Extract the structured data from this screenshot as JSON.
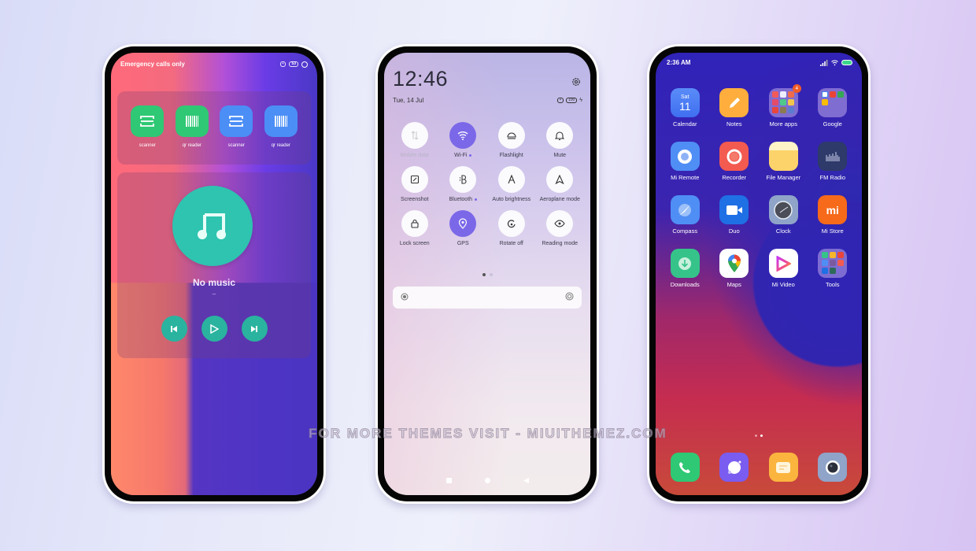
{
  "phone1": {
    "status_text": "Emergency calls only",
    "status_icons": [
      "screen-record-icon",
      "battery-53-icon",
      "settings-circle-icon"
    ],
    "battery_level": "53",
    "widgets": [
      {
        "label": "scanner",
        "icon": "scanner-icon",
        "color": "#2fc874"
      },
      {
        "label": "qr reader",
        "icon": "barcode-icon",
        "color": "#2fc874"
      },
      {
        "label": "scanner",
        "icon": "scanner-icon",
        "color": "#4b8ef6"
      },
      {
        "label": "qr reader",
        "icon": "barcode-icon",
        "color": "#4b8ef6"
      }
    ],
    "music": {
      "title": "No music",
      "subtitle": "–",
      "controls": [
        "previous",
        "play",
        "next"
      ],
      "accent": "#2ec4b0"
    }
  },
  "phone2": {
    "time": "12:46",
    "date": "Tue, 14 Jul",
    "battery_level": "100",
    "tiles": [
      {
        "label": "Mobile data",
        "icon": "mobile-data-icon",
        "active": false,
        "disabled": true,
        "dot": false
      },
      {
        "label": "Wi-Fi",
        "icon": "wifi-icon",
        "active": true,
        "disabled": false,
        "dot": true
      },
      {
        "label": "Flashlight",
        "icon": "flashlight-icon",
        "active": false,
        "disabled": false,
        "dot": false
      },
      {
        "label": "Mute",
        "icon": "bell-icon",
        "active": false,
        "disabled": false,
        "dot": false
      },
      {
        "label": "Screenshot",
        "icon": "screenshot-icon",
        "active": false,
        "disabled": false,
        "dot": false
      },
      {
        "label": "Bluetooth",
        "icon": "bluetooth-icon",
        "active": false,
        "disabled": false,
        "dot": true
      },
      {
        "label": "Auto brightness",
        "icon": "auto-brightness-icon",
        "active": false,
        "disabled": false,
        "dot": false
      },
      {
        "label": "Aeroplane mode",
        "icon": "aeroplane-icon",
        "active": false,
        "disabled": false,
        "dot": false
      },
      {
        "label": "Lock screen",
        "icon": "lock-icon",
        "active": false,
        "disabled": false,
        "dot": false
      },
      {
        "label": "GPS",
        "icon": "location-icon",
        "active": true,
        "disabled": false,
        "dot": false
      },
      {
        "label": "Rotate off",
        "icon": "rotate-icon",
        "active": false,
        "disabled": false,
        "dot": false
      },
      {
        "label": "Reading mode",
        "icon": "eye-icon",
        "active": false,
        "disabled": false,
        "dot": false
      }
    ],
    "page_indicator": {
      "current": 1,
      "total": 2
    },
    "accent": "#7b68e8"
  },
  "phone3": {
    "time": "2:36 AM",
    "apps": [
      {
        "label": "Calendar",
        "icon": "calendar-icon",
        "day": "Sat",
        "date": "11"
      },
      {
        "label": "Notes",
        "icon": "notes-icon"
      },
      {
        "label": "More apps",
        "icon": "folder-icon",
        "badge": "4"
      },
      {
        "label": "Google",
        "icon": "folder-icon"
      },
      {
        "label": "Mi Remote",
        "icon": "remote-icon"
      },
      {
        "label": "Recorder",
        "icon": "recorder-icon"
      },
      {
        "label": "File Manager",
        "icon": "file-manager-icon"
      },
      {
        "label": "FM Radio",
        "icon": "radio-icon"
      },
      {
        "label": "Compass",
        "icon": "compass-icon"
      },
      {
        "label": "Duo",
        "icon": "video-call-icon"
      },
      {
        "label": "Clock",
        "icon": "clock-icon"
      },
      {
        "label": "Mi Store",
        "icon": "mi-store-icon",
        "logo_text": "mi"
      },
      {
        "label": "Downloads",
        "icon": "download-icon"
      },
      {
        "label": "Maps",
        "icon": "maps-pin-icon"
      },
      {
        "label": "Mi Video",
        "icon": "play-icon"
      },
      {
        "label": "Tools",
        "icon": "folder-icon"
      }
    ],
    "dock": [
      {
        "name": "phone",
        "icon": "phone-icon"
      },
      {
        "name": "messages",
        "icon": "chat-bubble-icon"
      },
      {
        "name": "notes",
        "icon": "message-icon"
      },
      {
        "name": "camera",
        "icon": "camera-icon"
      }
    ],
    "page_indicator": {
      "current": 2,
      "total": 2
    }
  },
  "watermark": "FOR MORE THEMES VISIT - MIUITHEMEZ.COM"
}
